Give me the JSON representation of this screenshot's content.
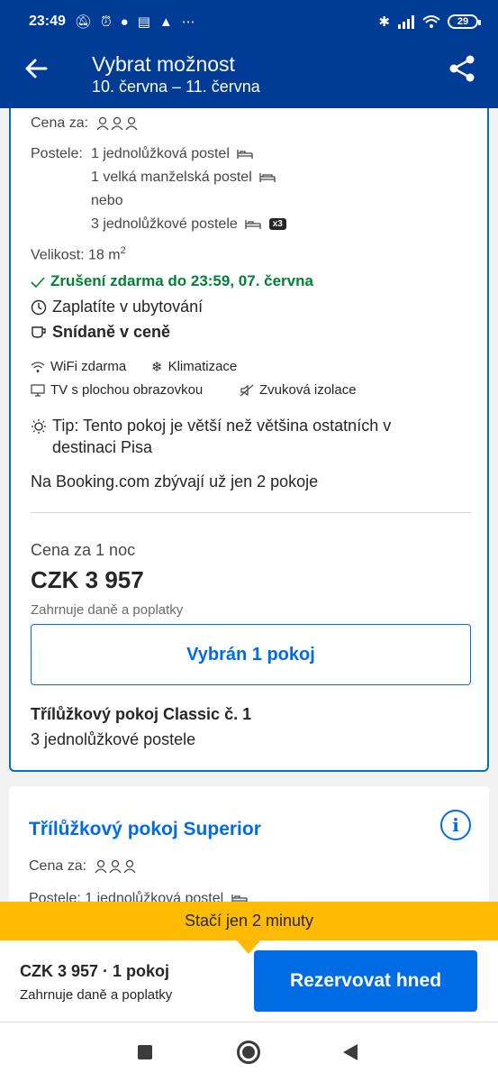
{
  "status_bar": {
    "time": "23:49",
    "battery": "29"
  },
  "header": {
    "title": "Vybrat možnost",
    "dates": "10. června – 11. června"
  },
  "room1": {
    "price_for_label": "Cena za:",
    "beds_label": "Postele:",
    "beds": [
      "1 jednolůžková postel",
      "1 velká manželská postel",
      "nebo",
      "3 jednolůžkové postele"
    ],
    "beds_multiplier": "x3",
    "size_label": "Velikost: 18 m",
    "size_sup": "2",
    "free_cancellation": "Zrušení zdarma do 23:59, 07. června",
    "pay_at_property": "Zaplatíte v ubytování",
    "breakfast": "Snídaně v ceně",
    "facilities": [
      "WiFi zdarma",
      "Klimatizace",
      "TV s plochou obrazovkou",
      "Zvuková izolace"
    ],
    "tip_line1": "Tip: Tento pokoj je větší než většina ostatních v",
    "tip_line2": "destinaci Pisa",
    "availability": "Na Booking.com zbývají už jen 2 pokoje",
    "price_per_night_label": "Cena za 1 noc",
    "price": "CZK 3 957",
    "price_note": "Zahrnuje daně a poplatky",
    "selected_button": "Vybrán 1 pokoj",
    "selected_room_name": "Třílůžkový pokoj Classic č. 1",
    "selected_room_beds": "3 jednolůžkové postele"
  },
  "room2": {
    "title": "Třílůžkový pokoj Superior",
    "price_for_label": "Cena za:",
    "beds_partial": "Postele: 1 jednolůžková postel"
  },
  "urgency": "Stačí jen 2 minuty",
  "booking_bar": {
    "summary": "CZK 3 957 · 1 pokoj",
    "note": "Zahrnuje daně a poplatky",
    "reserve_button": "Rezervovat hned"
  },
  "colors": {
    "brand_dark": "#003b95",
    "action_blue": "#006ce4",
    "success_green": "#008234",
    "urgency_yellow": "#febb02"
  }
}
